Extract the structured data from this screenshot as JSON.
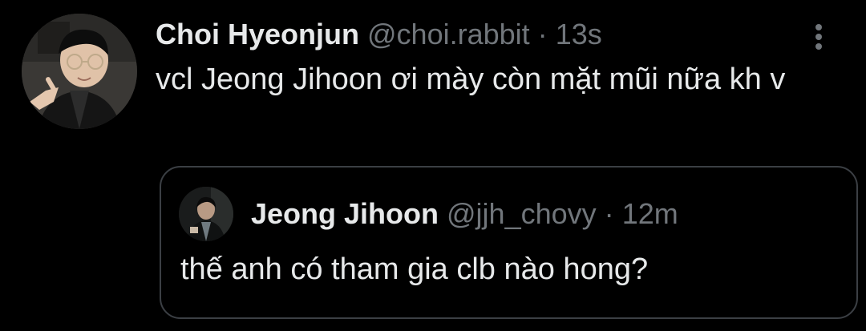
{
  "tweet": {
    "display_name": "Choi Hyeonjun",
    "handle": "@choi.rabbit",
    "separator": "·",
    "time": "13s",
    "text": "vcl Jeong Jihoon ơi mày còn mặt mũi nữa kh v",
    "avatar_icon": "user-avatar"
  },
  "quote": {
    "display_name": "Jeong Jihoon",
    "handle": "@jjh_chovy",
    "separator": "·",
    "time": "12m",
    "text": "thế anh có tham gia clb nào hong?",
    "avatar_icon": "user-avatar"
  },
  "menu": {
    "icon": "more-vertical-icon"
  },
  "colors": {
    "background": "#000000",
    "primary_text": "#e7e9ea",
    "secondary_text": "#71767b",
    "border": "#3b3f44"
  }
}
